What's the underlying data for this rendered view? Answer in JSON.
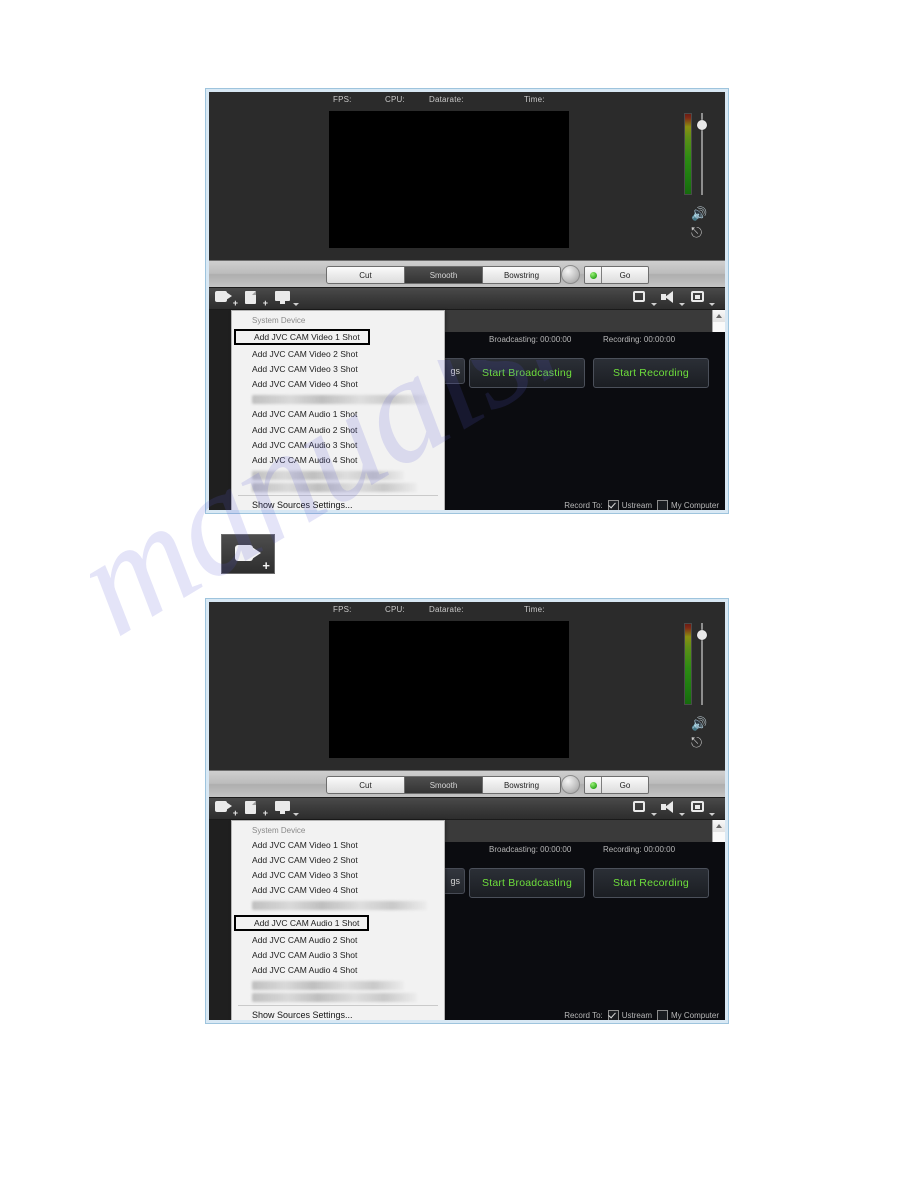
{
  "page": {
    "watermark_text": "manualshive.com"
  },
  "app": {
    "stats": {
      "fps_label": "FPS:",
      "cpu_label": "CPU:",
      "datarate_label": "Datarate:",
      "time_label": "Time:"
    },
    "transitions": {
      "cut": "Cut",
      "smooth": "Smooth",
      "bowstring": "Bowstring",
      "go": "Go"
    },
    "toolbar": {
      "add_camera_icon": "camcorder-plus-icon",
      "add_media_icon": "document-plus-icon",
      "add_screen_icon": "monitor-icon",
      "layout_icon": "square-icon",
      "audio_icon": "speaker-icon",
      "pip_icon": "picture-in-picture-icon"
    },
    "meter": {
      "speaker_icon": "speaker-volume-icon",
      "headphone_icon": "headphone-icon"
    },
    "broadcast": {
      "broadcasting_timer": "Broadcasting: 00:00:00",
      "recording_timer": "Recording: 00:00:00",
      "settings_label": "gs",
      "start_broadcasting": "Start Broadcasting",
      "start_recording": "Start Recording",
      "record_to_label": "Record To:",
      "ustream_label": "Ustream",
      "my_computer_label": "My Computer"
    },
    "menu": {
      "header": "System Device",
      "footer": "Show Sources Settings...",
      "items": [
        "Add JVC CAM Video 1 Shot",
        "Add JVC CAM Video 2 Shot",
        "Add JVC CAM Video 3 Shot",
        "Add JVC CAM Video 4 Shot",
        "Add JVC CAM Audio 1 Shot",
        "Add JVC CAM Audio 2 Shot",
        "Add JVC CAM Audio 3 Shot",
        "Add JVC CAM Audio 4 Shot"
      ]
    }
  },
  "figure1": {
    "highlighted_item": "Add JVC CAM Video 1 Shot"
  },
  "figure2": {
    "highlighted_item": "Add JVC CAM Audio 1 Shot"
  },
  "cam_button": {
    "icon": "camcorder-plus-icon"
  }
}
